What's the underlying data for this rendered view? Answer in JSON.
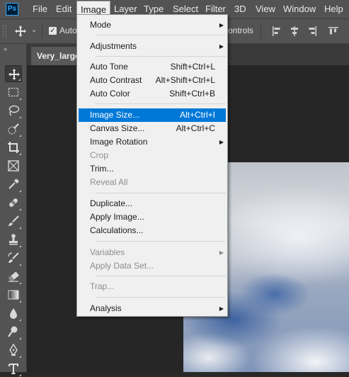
{
  "app": {
    "logo": "Ps"
  },
  "menubar": {
    "items": [
      {
        "label": "File"
      },
      {
        "label": "Edit"
      },
      {
        "label": "Image"
      },
      {
        "label": "Layer"
      },
      {
        "label": "Type"
      },
      {
        "label": "Select"
      },
      {
        "label": "Filter"
      },
      {
        "label": "3D"
      },
      {
        "label": "View"
      },
      {
        "label": "Window"
      },
      {
        "label": "Help"
      }
    ]
  },
  "options_bar": {
    "auto_select_label": "Auto-",
    "auto_select_checked": true,
    "show_transform_label": "ontrols"
  },
  "toolbar": {
    "collapse_glyph": "››",
    "tools": [
      {
        "icon": "move-icon"
      },
      {
        "icon": "marquee-icon"
      },
      {
        "icon": "lasso-icon"
      },
      {
        "icon": "quick-selection-icon"
      },
      {
        "icon": "crop-icon"
      },
      {
        "icon": "frame-icon"
      },
      {
        "icon": "eyedropper-icon"
      },
      {
        "icon": "healing-brush-icon"
      },
      {
        "icon": "brush-icon"
      },
      {
        "icon": "clone-stamp-icon"
      },
      {
        "icon": "history-brush-icon"
      },
      {
        "icon": "eraser-icon"
      },
      {
        "icon": "gradient-icon"
      },
      {
        "icon": "blur-icon"
      },
      {
        "icon": "dodge-icon"
      },
      {
        "icon": "pen-icon"
      },
      {
        "icon": "type-icon"
      }
    ]
  },
  "document": {
    "tab_title": "Very_large_"
  },
  "image_menu": {
    "mode": "Mode",
    "adjustments": "Adjustments",
    "auto_tone": "Auto Tone",
    "auto_tone_sc": "Shift+Ctrl+L",
    "auto_contrast": "Auto Contrast",
    "auto_contrast_sc": "Alt+Shift+Ctrl+L",
    "auto_color": "Auto Color",
    "auto_color_sc": "Shift+Ctrl+B",
    "image_size": "Image Size...",
    "image_size_sc": "Alt+Ctrl+I",
    "canvas_size": "Canvas Size...",
    "canvas_size_sc": "Alt+Ctrl+C",
    "image_rotation": "Image Rotation",
    "crop": "Crop",
    "trim": "Trim...",
    "reveal_all": "Reveal All",
    "duplicate": "Duplicate...",
    "apply_image": "Apply Image...",
    "calculations": "Calculations...",
    "variables": "Variables",
    "apply_data_set": "Apply Data Set...",
    "trap": "Trap...",
    "analysis": "Analysis",
    "submenu_glyph": "▶"
  },
  "colors": {
    "menu_highlight": "#0078d7",
    "ps_accent": "#31a8ff",
    "ui_panel": "#535353"
  }
}
